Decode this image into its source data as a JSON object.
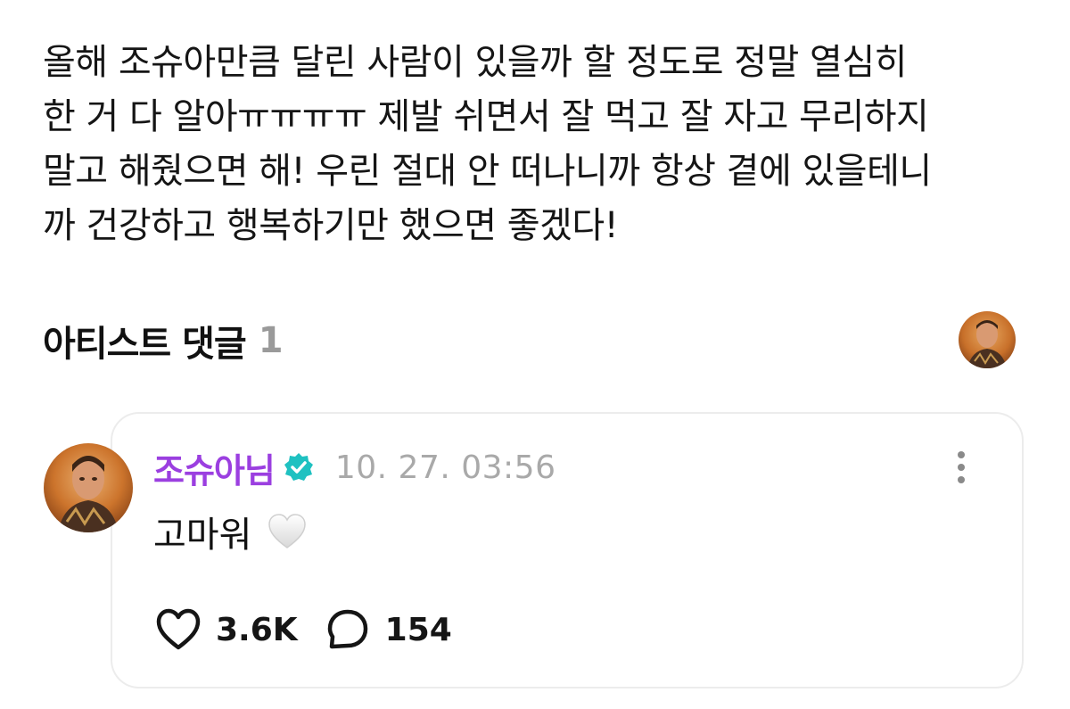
{
  "post": {
    "text": "올해 조슈아만큼 달린 사람이 있을까 할 정도로 정말 열심히\n한 거 다 알아ㅠㅠㅠㅠ 제발 쉬면서 잘 먹고 잘 자고 무리하지\n말고 해줬으면 해! 우린 절대 안 떠나니까 항상 곁에 있을테니\n까 건강하고 행복하기만 했으면 좋겠다!"
  },
  "artist_comments": {
    "title": "아티스트 댓글",
    "count": "1",
    "comment": {
      "author": "조슈아님",
      "verified": true,
      "timestamp": "10. 27. 03:56",
      "text": "고마워",
      "emoji": "white-heart-icon",
      "likes": "3.6K",
      "replies": "154"
    }
  },
  "colors": {
    "author_name": "#9b3fe0",
    "verified_badge": "#1fc1c1",
    "timestamp": "#a9a9a9",
    "count_gray": "#9a9a9a",
    "card_border": "#ececec"
  },
  "icons": {
    "verified": "verified-badge-icon",
    "more": "more-vertical-icon",
    "like": "heart-outline-icon",
    "reply": "speech-bubble-icon"
  }
}
